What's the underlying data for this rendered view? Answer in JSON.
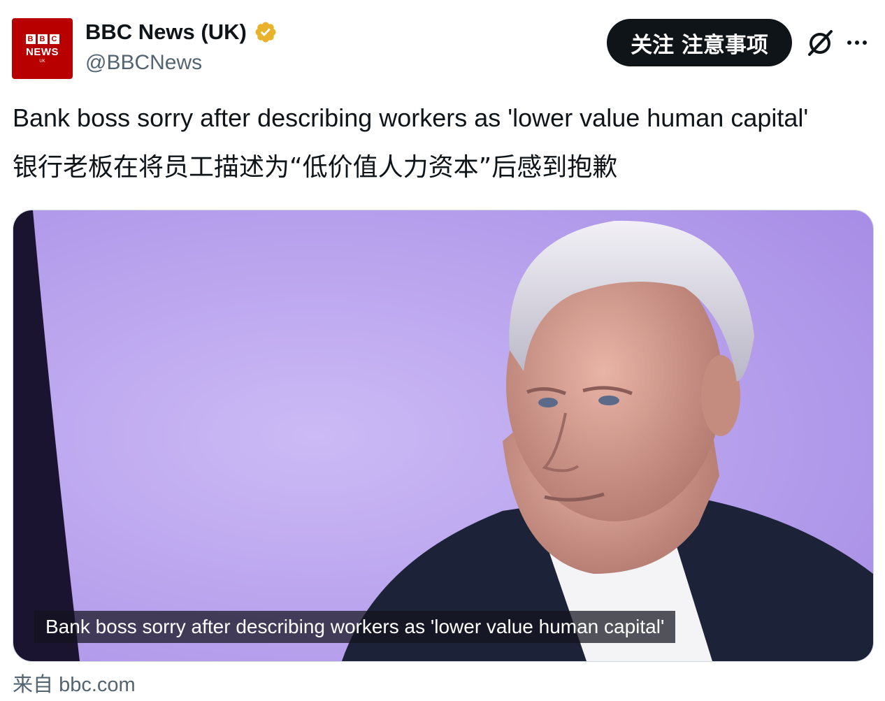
{
  "author": {
    "avatar": {
      "bbc_letters": [
        "B",
        "B",
        "C"
      ],
      "news": "NEWS",
      "region": "UK"
    },
    "display_name": "BBC News (UK)",
    "handle": "@BBCNews",
    "verified_icon": "gold-verified-badge"
  },
  "actions": {
    "follow_label": "关注 注意事项",
    "grok_icon": "grok-icon",
    "more_icon": "more-options-icon"
  },
  "tweet": {
    "text_en": "Bank boss sorry after describing workers as 'lower value human capital'",
    "text_zh": "银行老板在将员工描述为“低价值人力资本”后感到抱歉"
  },
  "card": {
    "caption": "Bank boss sorry after describing workers as 'lower value human capital'",
    "source_prefix": "来自",
    "source_domain": "bbc.com"
  },
  "colors": {
    "bbc_red": "#b80000",
    "verified_gold": "#e8b32a",
    "photo_background": "#b9a3ef",
    "text_primary": "#0f1419",
    "text_secondary": "#536471"
  }
}
